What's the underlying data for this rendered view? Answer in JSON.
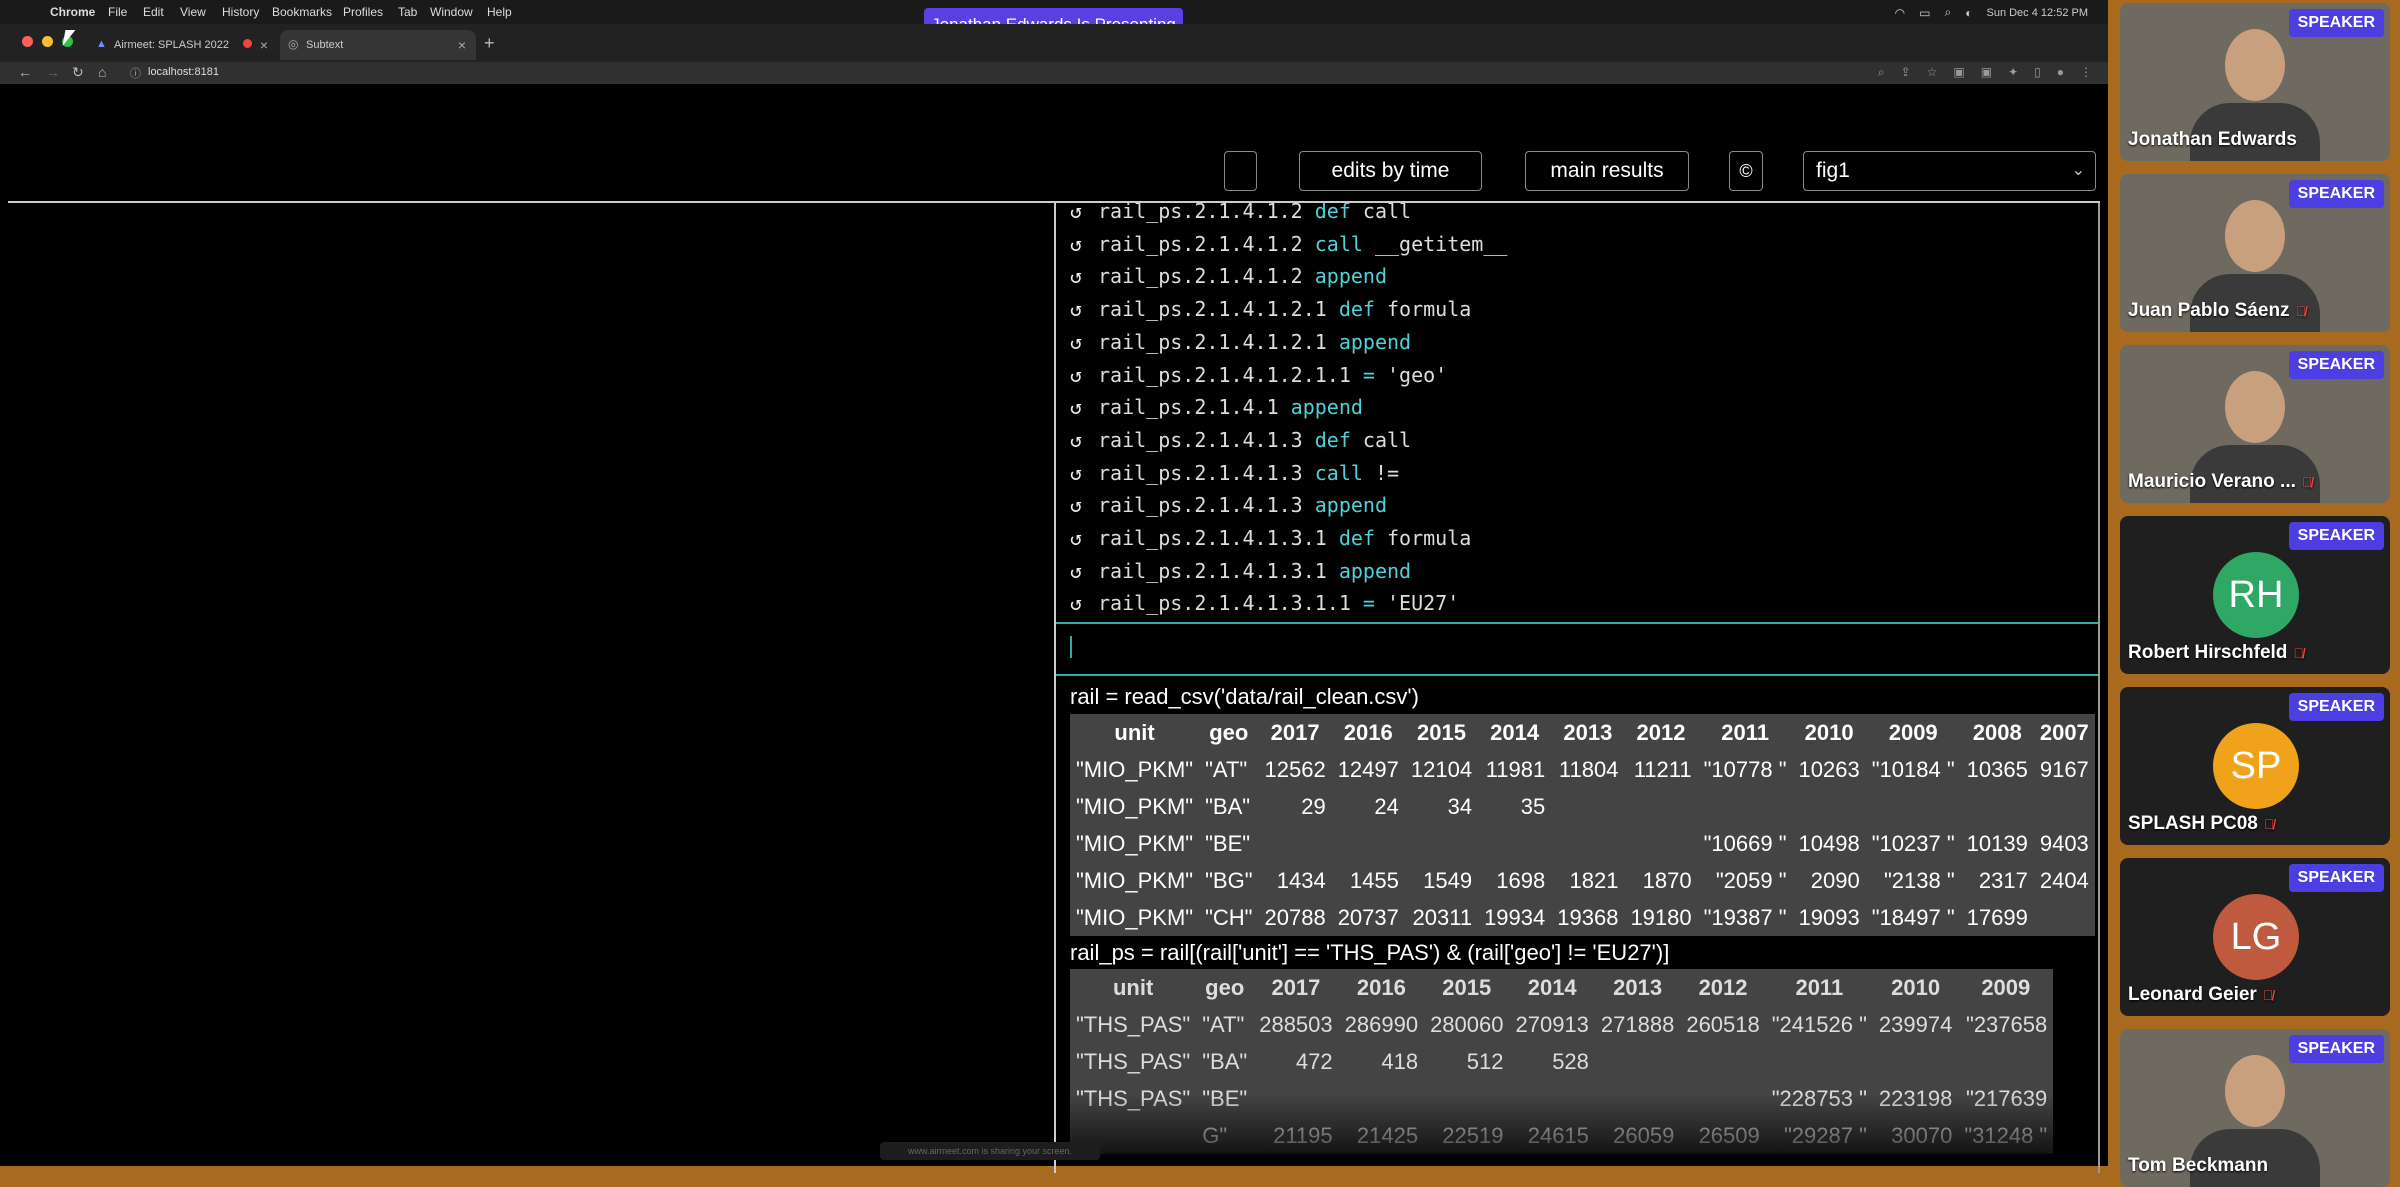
{
  "menubar": {
    "apple": "",
    "items": [
      "Chrome",
      "File",
      "Edit",
      "View",
      "History",
      "Bookmarks",
      "Profiles",
      "Tab",
      "Window",
      "Help"
    ],
    "presenting_banner": "Jonathan Edwards Is Presenting",
    "datetime": "Sun Dec 4  12:52 PM"
  },
  "browser": {
    "tabs": [
      {
        "label": "Airmeet: SPLASH 2022"
      },
      {
        "label": "Subtext"
      }
    ],
    "new_tab": "+",
    "url": "localhost:8181"
  },
  "app": {
    "buttons": {
      "edits_by_time": "edits by time",
      "main_results": "main results",
      "circle_icon": "©"
    },
    "figure_select": {
      "value": "fig1",
      "chevron": "⌄"
    },
    "trace": [
      {
        "path": "rail_ps.2.1.4.1.2",
        "op": "def",
        "rest": "call"
      },
      {
        "path": "rail_ps.2.1.4.1.2",
        "op": "call",
        "rest": "__getitem__"
      },
      {
        "path": "rail_ps.2.1.4.1.2",
        "op": "append",
        "rest": ""
      },
      {
        "path": "rail_ps.2.1.4.1.2.1",
        "op": "def",
        "rest": "formula"
      },
      {
        "path": "rail_ps.2.1.4.1.2.1",
        "op": "append",
        "rest": ""
      },
      {
        "path": "rail_ps.2.1.4.1.2.1.1",
        "op": "=",
        "rest": "'geo'"
      },
      {
        "path": "rail_ps.2.1.4.1",
        "op": "append",
        "rest": ""
      },
      {
        "path": "rail_ps.2.1.4.1.3",
        "op": "def",
        "rest": "call"
      },
      {
        "path": "rail_ps.2.1.4.1.3",
        "op": "call",
        "rest": "!="
      },
      {
        "path": "rail_ps.2.1.4.1.3",
        "op": "append",
        "rest": ""
      },
      {
        "path": "rail_ps.2.1.4.1.3.1",
        "op": "def",
        "rest": "formula"
      },
      {
        "path": "rail_ps.2.1.4.1.3.1",
        "op": "append",
        "rest": ""
      },
      {
        "path": "rail_ps.2.1.4.1.3.1.1",
        "op": "=",
        "rest": "'EU27'"
      }
    ],
    "output": {
      "code1": "rail = read_csv('data/rail_clean.csv')",
      "table1": {
        "headers": [
          "unit",
          "geo",
          "2017",
          "2016",
          "2015",
          "2014",
          "2013",
          "2012",
          "2011",
          "2010",
          "2009",
          "2008",
          "2007"
        ],
        "rows": [
          [
            "\"MIO_PKM\"",
            "\"AT\"",
            "12562",
            "12497",
            "12104",
            "11981",
            "11804",
            "11211",
            "\"10778 \"",
            "10263",
            "\"10184 \"",
            "10365",
            "9167"
          ],
          [
            "\"MIO_PKM\"",
            "\"BA\"",
            "29",
            "24",
            "34",
            "35",
            "",
            "",
            "",
            "",
            "",
            "",
            ""
          ],
          [
            "\"MIO_PKM\"",
            "\"BE\"",
            "",
            "",
            "",
            "",
            "",
            "",
            "\"10669 \"",
            "10498",
            "\"10237 \"",
            "10139",
            "9403"
          ],
          [
            "\"MIO_PKM\"",
            "\"BG\"",
            "1434",
            "1455",
            "1549",
            "1698",
            "1821",
            "1870",
            "\"2059 \"",
            "2090",
            "\"2138 \"",
            "2317",
            "2404"
          ],
          [
            "\"MIO_PKM\"",
            "\"CH\"",
            "20788",
            "20737",
            "20311",
            "19934",
            "19368",
            "19180",
            "\"19387 \"",
            "19093",
            "\"18497 \"",
            "17699",
            ""
          ]
        ]
      },
      "code2": "rail_ps = rail[(rail['unit'] == 'THS_PAS') & (rail['geo'] != 'EU27')]",
      "table2": {
        "headers": [
          "unit",
          "geo",
          "2017",
          "2016",
          "2015",
          "2014",
          "2013",
          "2012",
          "2011",
          "2010",
          "2009"
        ],
        "rows": [
          [
            "\"THS_PAS\"",
            "\"AT\"",
            "288503",
            "286990",
            "280060",
            "270913",
            "271888",
            "260518",
            "\"241526 \"",
            "239974",
            "\"237658"
          ],
          [
            "\"THS_PAS\"",
            "\"BA\"",
            "472",
            "418",
            "512",
            "528",
            "",
            "",
            "",
            "",
            ""
          ],
          [
            "\"THS_PAS\"",
            "\"BE\"",
            "",
            "",
            "",
            "",
            "",
            "",
            "\"228753 \"",
            "223198",
            "\"217639"
          ],
          [
            "",
            "G\"",
            "21195",
            "21425",
            "22519",
            "24615",
            "26059",
            "26509",
            "\"29287 \"",
            "30070",
            "\"31248 \""
          ]
        ]
      },
      "share_notice": "www.airmeet.com is sharing your screen."
    }
  },
  "participants": {
    "badge": "SPEAKER",
    "list": [
      {
        "name": "Jonathan Edwards",
        "initials": "",
        "color": "",
        "muted": false
      },
      {
        "name": "Juan Pablo Sáenz",
        "initials": "",
        "color": "",
        "muted": true
      },
      {
        "name": "Mauricio Verano ...",
        "initials": "",
        "color": "",
        "muted": true
      },
      {
        "name": "Robert Hirschfeld",
        "initials": "RH",
        "color": "#2fa866",
        "muted": true
      },
      {
        "name": "SPLASH PC08",
        "initials": "SP",
        "color": "#f0a21b",
        "muted": true
      },
      {
        "name": "Leonard Geier",
        "initials": "LG",
        "color": "#bf5a3f",
        "muted": true
      },
      {
        "name": "Tom Beckmann",
        "initials": "",
        "color": "",
        "muted": false
      }
    ]
  }
}
